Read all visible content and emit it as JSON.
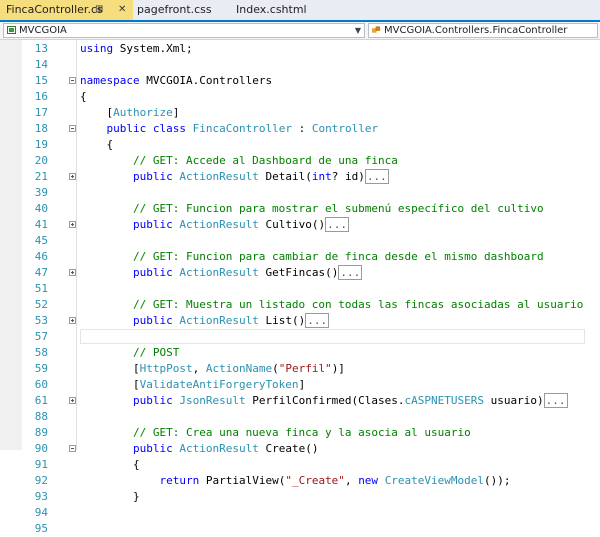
{
  "tabs": [
    {
      "label": "FincaController.cs",
      "active": true
    },
    {
      "label": "pagefront.css",
      "active": false
    },
    {
      "label": "Index.cshtml",
      "active": false
    }
  ],
  "tab_icons": {
    "pin": "⊞",
    "close": "✕"
  },
  "nav": {
    "project": "MVCGOIA",
    "class": "MVCGOIA.Controllers.FincaController"
  },
  "colors": {
    "keyword": "#0000ff",
    "type": "#2b91af",
    "comment": "#008000",
    "string": "#a31515",
    "accent": "#007acc",
    "active_tab": "#f6dd7d"
  },
  "lines": [
    {
      "n": "13",
      "fold": null,
      "hl": false,
      "tokens": [
        [
          "kw",
          "using"
        ],
        [
          "pl",
          " System.Xml;"
        ]
      ]
    },
    {
      "n": "14",
      "fold": null,
      "hl": false,
      "tokens": []
    },
    {
      "n": "15",
      "fold": "open",
      "hl": false,
      "tokens": [
        [
          "kw",
          "namespace"
        ],
        [
          "pl",
          " MVCGOIA.Controllers"
        ]
      ]
    },
    {
      "n": "16",
      "fold": null,
      "hl": false,
      "tokens": [
        [
          "pl",
          "{"
        ]
      ]
    },
    {
      "n": "17",
      "fold": null,
      "hl": false,
      "tokens": [
        [
          "pl",
          "    ["
        ],
        [
          "ty",
          "Authorize"
        ],
        [
          "pl",
          "]"
        ]
      ]
    },
    {
      "n": "18",
      "fold": "open",
      "hl": false,
      "tokens": [
        [
          "pl",
          "    "
        ],
        [
          "kw",
          "public"
        ],
        [
          "pl",
          " "
        ],
        [
          "kw",
          "class"
        ],
        [
          "pl",
          " "
        ],
        [
          "ty",
          "FincaController"
        ],
        [
          "pl",
          " : "
        ],
        [
          "ty",
          "Controller"
        ]
      ]
    },
    {
      "n": "19",
      "fold": null,
      "hl": false,
      "tokens": [
        [
          "pl",
          "    {"
        ]
      ]
    },
    {
      "n": "20",
      "fold": null,
      "hl": false,
      "tokens": [
        [
          "cm",
          "        // GET: Accede al Dashboard de una finca"
        ]
      ]
    },
    {
      "n": "21",
      "fold": "closed",
      "hl": false,
      "tokens": [
        [
          "pl",
          "        "
        ],
        [
          "kw",
          "public"
        ],
        [
          "pl",
          " "
        ],
        [
          "ty",
          "ActionResult"
        ],
        [
          "pl",
          " Detail("
        ],
        [
          "kw",
          "int"
        ],
        [
          "pl",
          "? id)"
        ],
        [
          "col",
          "..."
        ]
      ]
    },
    {
      "n": "39",
      "fold": null,
      "hl": false,
      "tokens": []
    },
    {
      "n": "40",
      "fold": null,
      "hl": false,
      "tokens": [
        [
          "cm",
          "        // GET: Funcion para mostrar el submenú específico del cultivo"
        ]
      ]
    },
    {
      "n": "41",
      "fold": "closed",
      "hl": false,
      "tokens": [
        [
          "pl",
          "        "
        ],
        [
          "kw",
          "public"
        ],
        [
          "pl",
          " "
        ],
        [
          "ty",
          "ActionResult"
        ],
        [
          "pl",
          " Cultivo()"
        ],
        [
          "col",
          "..."
        ]
      ]
    },
    {
      "n": "45",
      "fold": null,
      "hl": false,
      "tokens": []
    },
    {
      "n": "46",
      "fold": null,
      "hl": false,
      "tokens": [
        [
          "cm",
          "        // GET: Funcion para cambiar de finca desde el mismo dashboard"
        ]
      ]
    },
    {
      "n": "47",
      "fold": "closed",
      "hl": false,
      "tokens": [
        [
          "pl",
          "        "
        ],
        [
          "kw",
          "public"
        ],
        [
          "pl",
          " "
        ],
        [
          "ty",
          "ActionResult"
        ],
        [
          "pl",
          " GetFincas()"
        ],
        [
          "col",
          "..."
        ]
      ]
    },
    {
      "n": "51",
      "fold": null,
      "hl": false,
      "tokens": []
    },
    {
      "n": "52",
      "fold": null,
      "hl": false,
      "tokens": [
        [
          "cm",
          "        // GET: Muestra un listado con todas las fincas asociadas al usuario"
        ]
      ]
    },
    {
      "n": "53",
      "fold": "closed",
      "hl": false,
      "tokens": [
        [
          "pl",
          "        "
        ],
        [
          "kw",
          "public"
        ],
        [
          "pl",
          " "
        ],
        [
          "ty",
          "ActionResult"
        ],
        [
          "pl",
          " List()"
        ],
        [
          "col",
          "..."
        ]
      ]
    },
    {
      "n": "57",
      "fold": null,
      "hl": true,
      "tokens": []
    },
    {
      "n": "58",
      "fold": null,
      "hl": false,
      "tokens": [
        [
          "cm",
          "        // POST"
        ]
      ]
    },
    {
      "n": "59",
      "fold": null,
      "hl": false,
      "tokens": [
        [
          "pl",
          "        ["
        ],
        [
          "ty",
          "HttpPost"
        ],
        [
          "pl",
          ", "
        ],
        [
          "ty",
          "ActionName"
        ],
        [
          "pl",
          "("
        ],
        [
          "st",
          "\"Perfil\""
        ],
        [
          "pl",
          ")]"
        ]
      ]
    },
    {
      "n": "60",
      "fold": null,
      "hl": false,
      "tokens": [
        [
          "pl",
          "        ["
        ],
        [
          "ty",
          "ValidateAntiForgeryToken"
        ],
        [
          "pl",
          "]"
        ]
      ]
    },
    {
      "n": "61",
      "fold": "closed",
      "hl": false,
      "tokens": [
        [
          "pl",
          "        "
        ],
        [
          "kw",
          "public"
        ],
        [
          "pl",
          " "
        ],
        [
          "ty",
          "JsonResult"
        ],
        [
          "pl",
          " PerfilConfirmed(Clases."
        ],
        [
          "ty",
          "cASPNETUSERS"
        ],
        [
          "pl",
          " usuario)"
        ],
        [
          "col",
          "..."
        ]
      ]
    },
    {
      "n": "88",
      "fold": null,
      "hl": false,
      "tokens": []
    },
    {
      "n": "89",
      "fold": null,
      "hl": false,
      "tokens": [
        [
          "cm",
          "        // GET: Crea una nueva finca y la asocia al usuario"
        ]
      ]
    },
    {
      "n": "90",
      "fold": "open",
      "hl": false,
      "tokens": [
        [
          "pl",
          "        "
        ],
        [
          "kw",
          "public"
        ],
        [
          "pl",
          " "
        ],
        [
          "ty",
          "ActionResult"
        ],
        [
          "pl",
          " Create()"
        ]
      ]
    },
    {
      "n": "91",
      "fold": null,
      "hl": false,
      "tokens": [
        [
          "pl",
          "        {"
        ]
      ]
    },
    {
      "n": "92",
      "fold": null,
      "hl": false,
      "tokens": [
        [
          "pl",
          "            "
        ],
        [
          "kw",
          "return"
        ],
        [
          "pl",
          " PartialView("
        ],
        [
          "st",
          "\"_Create\""
        ],
        [
          "pl",
          ", "
        ],
        [
          "kw",
          "new"
        ],
        [
          "pl",
          " "
        ],
        [
          "ty",
          "CreateViewModel"
        ],
        [
          "pl",
          "());"
        ]
      ]
    },
    {
      "n": "93",
      "fold": null,
      "hl": false,
      "tokens": [
        [
          "pl",
          "        }"
        ]
      ]
    },
    {
      "n": "94",
      "fold": null,
      "hl": false,
      "tokens": []
    },
    {
      "n": "95",
      "fold": null,
      "hl": false,
      "tokens": []
    }
  ]
}
